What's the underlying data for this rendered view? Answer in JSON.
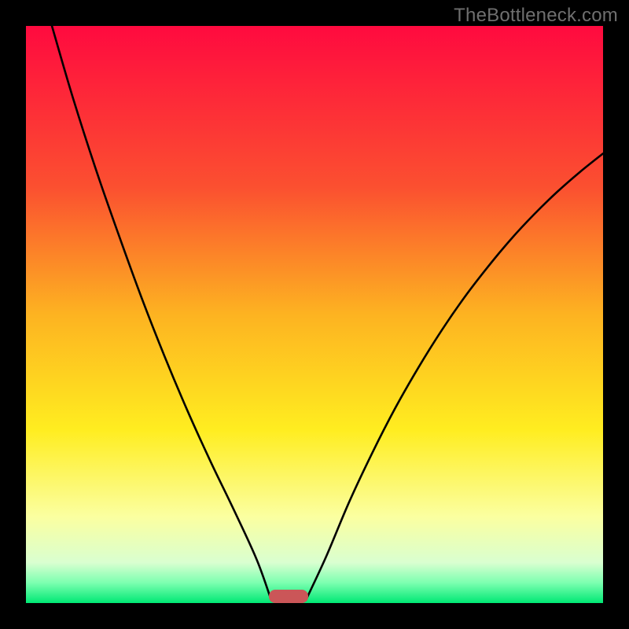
{
  "watermark": "TheBottleneck.com",
  "chart_data": {
    "type": "line",
    "title": "",
    "xlabel": "",
    "ylabel": "",
    "xlim": [
      0,
      100
    ],
    "ylim": [
      0,
      100
    ],
    "gradient": [
      {
        "pos": 0.0,
        "color": "#ff0a3f"
      },
      {
        "pos": 0.28,
        "color": "#fb5030"
      },
      {
        "pos": 0.5,
        "color": "#fdb321"
      },
      {
        "pos": 0.7,
        "color": "#ffed20"
      },
      {
        "pos": 0.85,
        "color": "#fbffa0"
      },
      {
        "pos": 0.93,
        "color": "#d9ffd0"
      },
      {
        "pos": 0.965,
        "color": "#7cffb0"
      },
      {
        "pos": 1.0,
        "color": "#00e874"
      }
    ],
    "series": [
      {
        "name": "left-curve",
        "x": [
          4.5,
          8,
          12,
          16,
          20,
          24,
          28,
          32,
          36,
          40,
          42.5
        ],
        "y": [
          100,
          88,
          75.5,
          64,
          53,
          42.8,
          33.3,
          24.5,
          16.2,
          7.5,
          0.5
        ]
      },
      {
        "name": "right-curve",
        "x": [
          48.5,
          52,
          56,
          60,
          64,
          68,
          72,
          76,
          80,
          84,
          88,
          92,
          96,
          100
        ],
        "y": [
          0.5,
          8,
          17.5,
          26,
          33.8,
          40.8,
          47.2,
          53,
          58.2,
          63,
          67.3,
          71.2,
          74.7,
          77.9
        ]
      }
    ],
    "marker": {
      "x_center": 45.5,
      "width": 6.8,
      "height": 2.3,
      "color": "#cb5658"
    },
    "plot_frame": {
      "outer": 800,
      "inner_offset": 33,
      "inner_size": 734
    }
  }
}
